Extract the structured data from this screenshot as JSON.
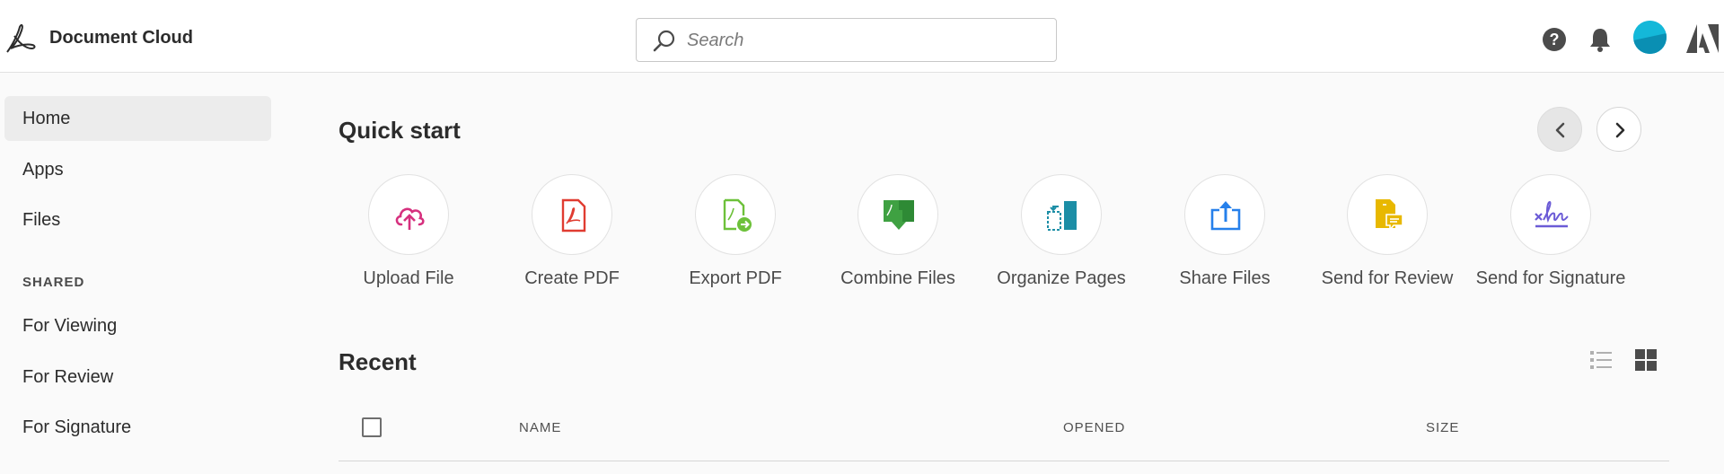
{
  "header": {
    "app_title": "Document Cloud",
    "search_placeholder": "Search",
    "icons": [
      "adobe-acrobat-logo",
      "search-icon",
      "help-icon",
      "bell-icon",
      "avatar",
      "adobe-logo"
    ]
  },
  "sidebar": {
    "items": [
      {
        "label": "Home",
        "active": true
      },
      {
        "label": "Apps",
        "active": false
      },
      {
        "label": "Files",
        "active": false
      }
    ],
    "shared_label": "SHARED",
    "shared_items": [
      {
        "label": "For Viewing"
      },
      {
        "label": "For Review"
      },
      {
        "label": "For Signature"
      }
    ]
  },
  "quick_start": {
    "title": "Quick start",
    "items": [
      {
        "label": "Upload File",
        "icon": "cloud-upload-icon",
        "color": "#d6307e"
      },
      {
        "label": "Create PDF",
        "icon": "create-pdf-icon",
        "color": "#e03c31"
      },
      {
        "label": "Export PDF",
        "icon": "export-pdf-icon",
        "color": "#6dc13a"
      },
      {
        "label": "Combine Files",
        "icon": "combine-files-icon",
        "color": "#3fa142"
      },
      {
        "label": "Organize Pages",
        "icon": "organize-pages-icon",
        "color": "#1c8ea6"
      },
      {
        "label": "Share Files",
        "icon": "share-files-icon",
        "color": "#2680eb"
      },
      {
        "label": "Send for Review",
        "icon": "send-for-review-icon",
        "color": "#e8b800"
      },
      {
        "label": "Send for Signature",
        "icon": "send-for-signature-icon",
        "color": "#6b5bd6"
      }
    ]
  },
  "recent": {
    "title": "Recent",
    "columns": [
      "NAME",
      "OPENED",
      "SIZE"
    ]
  }
}
